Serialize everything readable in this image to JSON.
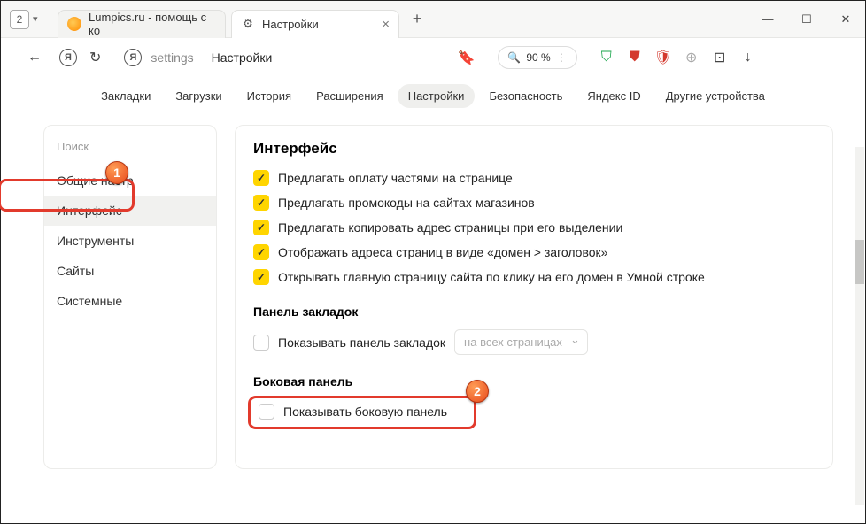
{
  "titlebar": {
    "tab_count": "2",
    "tab1_label": "Lumpics.ru - помощь с ко",
    "tab2_label": "Настройки"
  },
  "addr": {
    "path": "settings",
    "title": "Настройки",
    "zoom": "90 %"
  },
  "top_tabs": [
    "Закладки",
    "Загрузки",
    "История",
    "Расширения",
    "Настройки",
    "Безопасность",
    "Яндекс ID",
    "Другие устройства"
  ],
  "sidebar": {
    "search_placeholder": "Поиск",
    "items": [
      "Общие настр",
      "Интерфейс",
      "Инструменты",
      "Сайты",
      "Системные"
    ]
  },
  "main": {
    "heading": "Интерфейс",
    "opts": [
      "Предлагать оплату частями на странице",
      "Предлагать промокоды на сайтах магазинов",
      "Предлагать копировать адрес страницы при его выделении",
      "Отображать адреса страниц в виде «домен > заголовок»",
      "Открывать главную страницу сайта по клику на его домен в Умной строке"
    ],
    "bookmarks_heading": "Панель закладок",
    "bookmarks_opt": "Показывать панель закладок",
    "bookmarks_select": "на всех страницах",
    "sidepanel_heading": "Боковая панель",
    "sidepanel_opt": "Показывать боковую панель"
  },
  "badges": {
    "b1": "1",
    "b2": "2"
  }
}
